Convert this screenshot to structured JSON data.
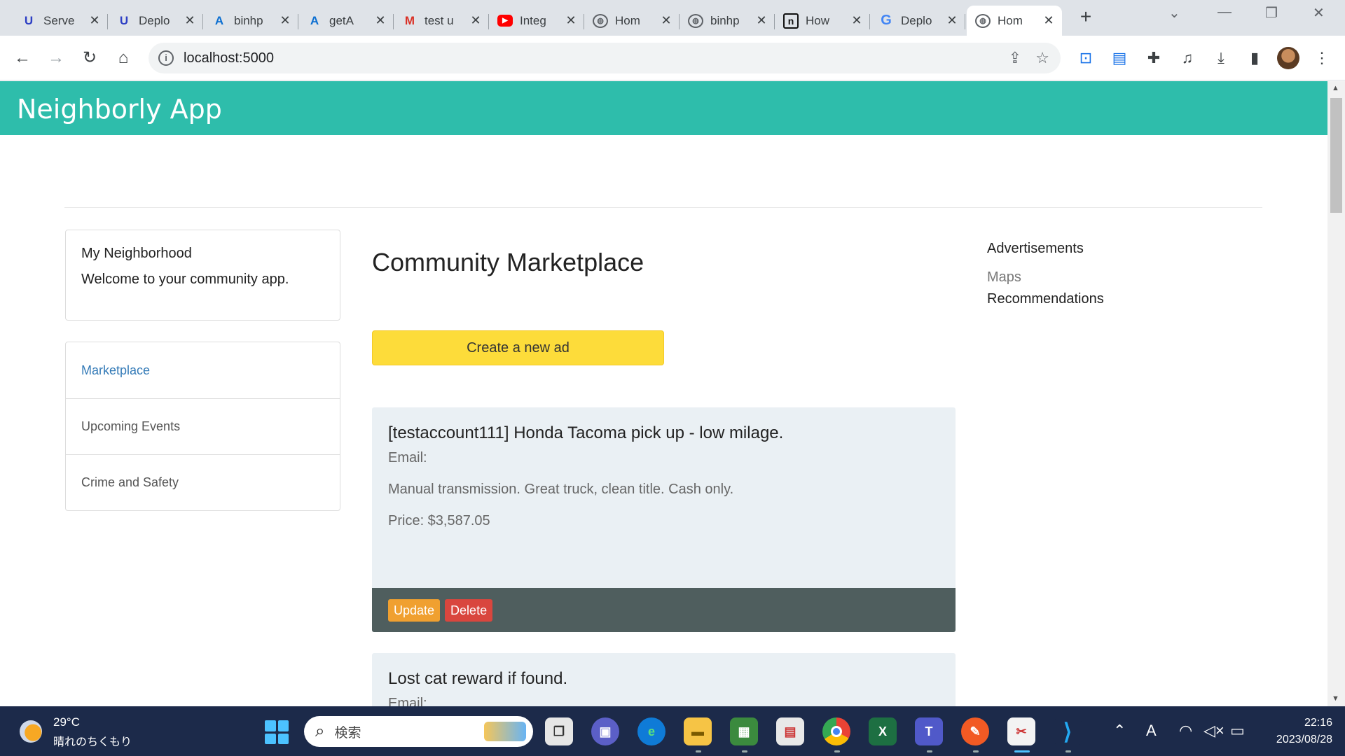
{
  "browser": {
    "tabs": [
      {
        "title": "Serve",
        "icon": "udacity-icon"
      },
      {
        "title": "Deplo",
        "icon": "udacity-icon"
      },
      {
        "title": "binhp",
        "icon": "azure-icon"
      },
      {
        "title": "getA",
        "icon": "azure-icon"
      },
      {
        "title": "test u",
        "icon": "gmail-icon"
      },
      {
        "title": "Integ",
        "icon": "youtube-icon"
      },
      {
        "title": "Hom",
        "icon": "globe-icon"
      },
      {
        "title": "binhp",
        "icon": "globe-icon"
      },
      {
        "title": "How",
        "icon": "notion-icon"
      },
      {
        "title": "Deplo",
        "icon": "google-icon"
      },
      {
        "title": "Hom",
        "icon": "globe-icon",
        "active": true
      }
    ],
    "url": "localhost:5000"
  },
  "app": {
    "brand": "Neighborly App"
  },
  "sidebar": {
    "panel_title": "My Neighborhood",
    "panel_text": "Welcome to your community app.",
    "items": [
      {
        "label": "Marketplace",
        "active": true
      },
      {
        "label": "Upcoming Events"
      },
      {
        "label": "Crime and Safety"
      }
    ]
  },
  "main": {
    "title": "Community Marketplace",
    "create_label": "Create a new ad",
    "ads": [
      {
        "title": "[testaccount111] Honda Tacoma pick up - low milage.",
        "email": "Email:",
        "description": "Manual transmission. Great truck, clean title. Cash only.",
        "price": "Price: $3,587.05",
        "update_label": "Update",
        "delete_label": "Delete"
      },
      {
        "title": "Lost cat reward if found.",
        "email": "Email:"
      }
    ]
  },
  "right": {
    "heading": "Advertisements",
    "link_maps": "Maps",
    "link_recommendations": "Recommendations"
  },
  "taskbar": {
    "weather_temp": "29°C",
    "weather_desc": "晴れのちくもり",
    "search_placeholder": "検索",
    "time": "22:16",
    "date": "2023/08/28"
  },
  "colors": {
    "appbar": "#2ebdab",
    "create_button": "#fddc3a",
    "card_bg": "#eaf0f4",
    "card_footer": "#4f5e5e",
    "update_button": "#f0a030",
    "delete_button": "#d9463e",
    "active_link": "#337ab7"
  }
}
